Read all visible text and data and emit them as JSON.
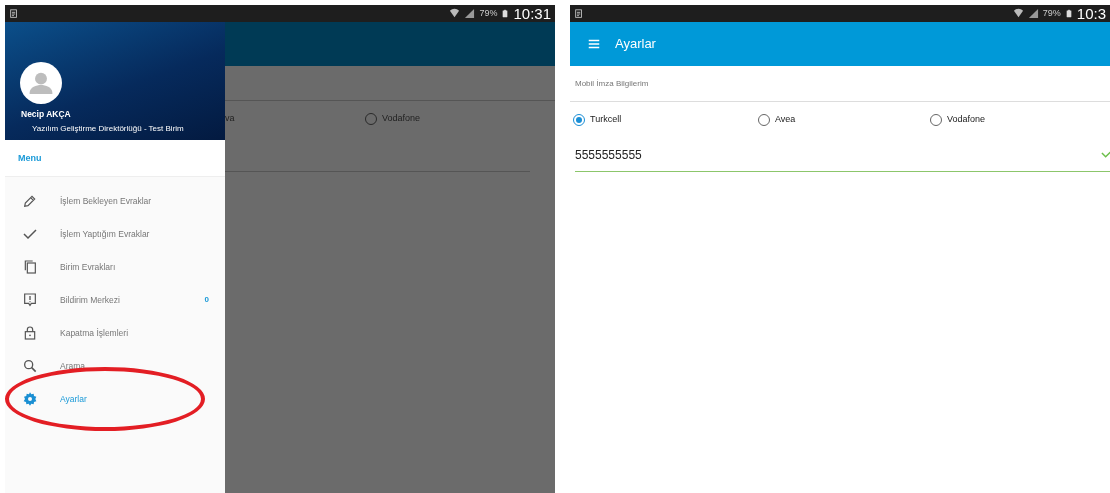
{
  "left_screen": {
    "status_bar": {
      "battery": "79%",
      "time": "10:31"
    },
    "background": {
      "radios": [
        {
          "kind": "cut_label",
          "label": "va"
        },
        {
          "kind": "radio",
          "label": "Vodafone",
          "selected": false
        }
      ]
    },
    "drawer": {
      "user_name": "Necip AKÇA",
      "user_unit": "Yazılım Geliştirme Direktörlüğü - Test Birim",
      "section_title": "Menu",
      "items": [
        {
          "label": "İşlem Bekleyen Evraklar",
          "selected": false,
          "highlighted": false
        },
        {
          "label": "İşlem Yaptığım Evraklar",
          "selected": false,
          "highlighted": false
        },
        {
          "label": "Birim Evrakları",
          "selected": false,
          "highlighted": false
        },
        {
          "label": "Bildirim Merkezi",
          "badge": "0",
          "selected": false,
          "highlighted": false
        },
        {
          "label": "Kapatma İşlemleri",
          "selected": false,
          "highlighted": false
        },
        {
          "label": "Arama",
          "selected": false,
          "highlighted": false
        },
        {
          "label": "Ayarlar",
          "selected": true,
          "highlighted": true
        }
      ]
    }
  },
  "right_screen": {
    "status_bar": {
      "battery": "79%",
      "time": "10:3"
    },
    "app_bar": {
      "title": "Ayarlar"
    },
    "section_label": "Mobil İmza Bilgilerim",
    "operators": [
      {
        "label": "Turkcell",
        "selected": true
      },
      {
        "label": "Avea",
        "selected": false
      },
      {
        "label": "Vodafone",
        "selected": false
      }
    ],
    "phone_field": {
      "value": "5555555555",
      "valid": true
    }
  }
}
